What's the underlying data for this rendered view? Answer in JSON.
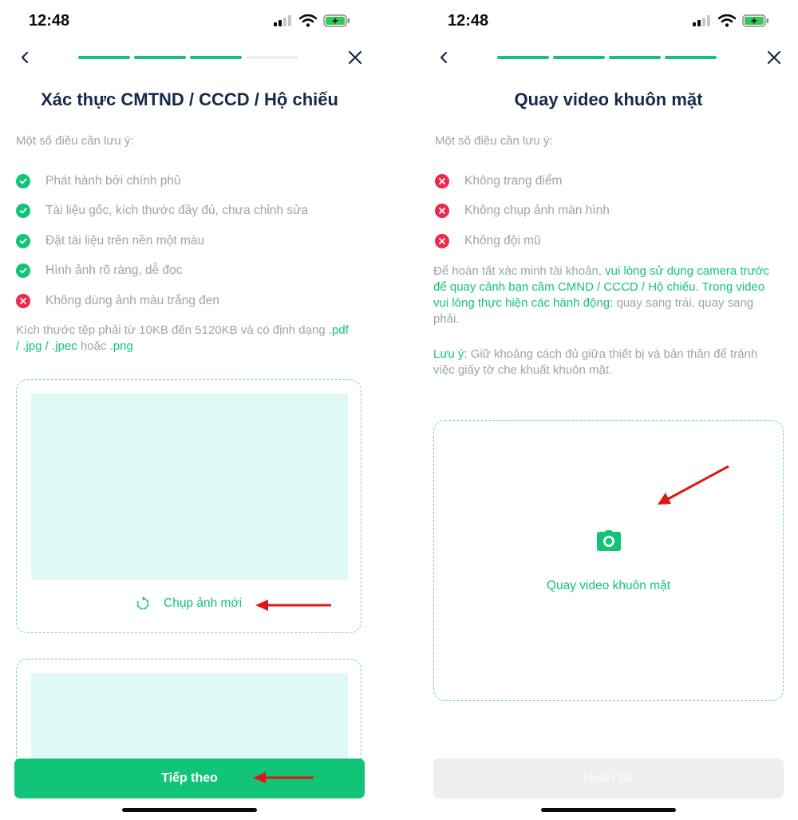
{
  "colors": {
    "accent": "#12c477",
    "error": "#f0284a",
    "title": "#16294a",
    "muted": "#9aa4b2",
    "preview_bg": "#dff9f6",
    "annotation_arrow": "#e01616"
  },
  "left_screen": {
    "status_bar": {
      "time": "12:48"
    },
    "progress": {
      "total_steps": 4,
      "completed_steps": 3
    },
    "title": "Xác thực CMTND / CCCD / Hộ chiếu",
    "notes_heading": "Một số điều cần lưu ý:",
    "checklist": [
      {
        "status": "ok",
        "icon": "check-circle-icon",
        "text": "Phát hành bởi chính phủ"
      },
      {
        "status": "ok",
        "icon": "check-circle-icon",
        "text": "Tài liệu gốc, kích thước đầy đủ, chưa chỉnh sửa"
      },
      {
        "status": "ok",
        "icon": "check-circle-icon",
        "text": "Đặt tài liệu trên nền một màu"
      },
      {
        "status": "ok",
        "icon": "check-circle-icon",
        "text": "Hình ảnh rõ ràng, dễ đọc"
      },
      {
        "status": "no",
        "icon": "x-circle-icon",
        "text": "Không dùng ảnh màu trắng đen"
      }
    ],
    "size_note": {
      "prefix": "Kích thước tệp phải từ 10KB đến 5120KB và có định dạng ",
      "formats": ".pdf / .jpg / .jpec",
      "middle": " hoặc ",
      "last_format": ".png"
    },
    "retake_label": "Chụp ảnh mới",
    "next_button": "Tiếp theo"
  },
  "right_screen": {
    "status_bar": {
      "time": "12:48"
    },
    "progress": {
      "total_steps": 4,
      "completed_steps": 4
    },
    "title": "Quay video khuôn mặt",
    "notes_heading": "Một số điều cần lưu ý:",
    "rules": [
      {
        "status": "no",
        "icon": "x-circle-icon",
        "text": "Không trang điểm"
      },
      {
        "status": "no",
        "icon": "x-circle-icon",
        "text": "Không chụp ảnh màn hình"
      },
      {
        "status": "no",
        "icon": "x-circle-icon",
        "text": "Không đội mũ"
      }
    ],
    "instruction": {
      "part1": "Để hoàn tất xác minh tài khoản, ",
      "highlight": "vui lòng sử dụng camera trước để quay cảnh bạn cầm CMND / CCCD / Hộ chiếu. Trong video vui lòng thực hiện các hành động:",
      "part2": " quay sang trái, quay sang phải."
    },
    "tip": {
      "label": "Lưu ý:",
      "text": " Giữ khoảng cách đủ giữa thiết bị và bản thân để tránh việc giấy tờ che khuất khuôn mặt."
    },
    "capture_label": "Quay video khuôn mặt",
    "complete_button": "Hoàn tất"
  }
}
